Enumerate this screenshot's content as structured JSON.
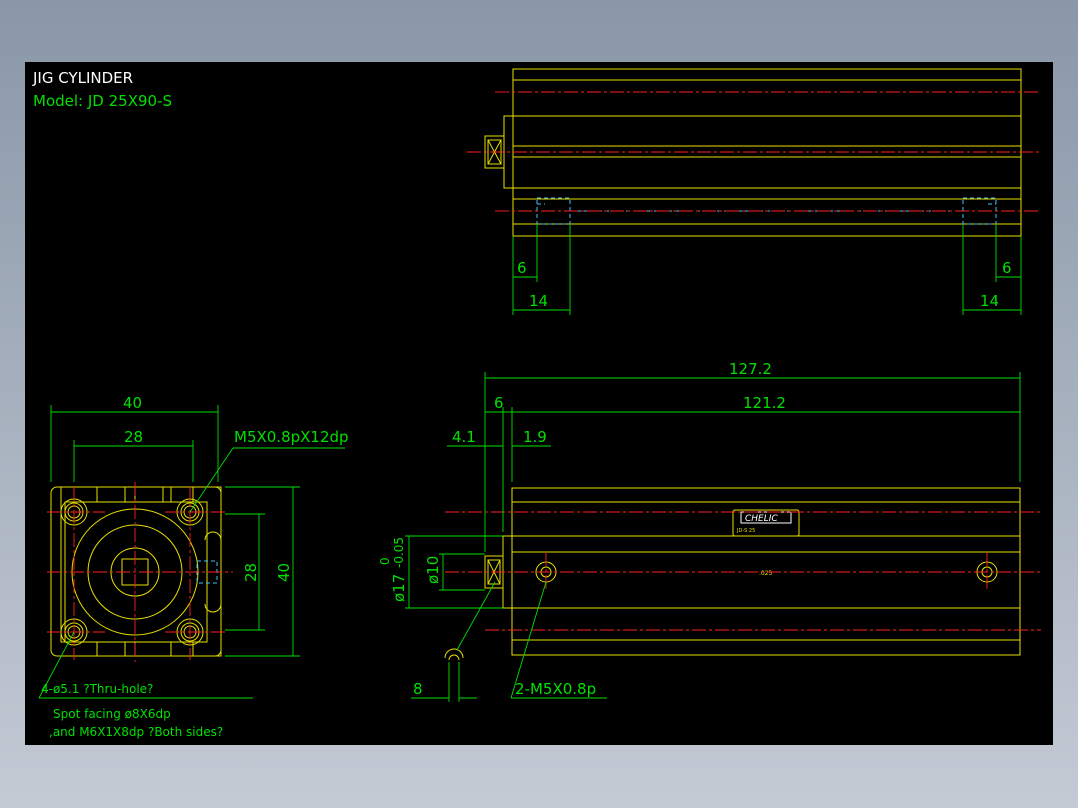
{
  "title": {
    "name": "JIG CYLINDER",
    "model": "Model: JD 25X90-S"
  },
  "colors": {
    "background": "#000000",
    "outline": "#e8e000",
    "dimension": "#00e000",
    "centerline": "#ff2020",
    "hidden": "#40c0ff"
  },
  "top_view": {
    "dims": {
      "left_inner": "6",
      "left_outer": "14",
      "right_inner": "6",
      "right_outer": "14"
    }
  },
  "front_view": {
    "dims": {
      "width": "40",
      "hole_pitch": "28",
      "thread_note": "M5X0.8pX12dp",
      "side_pitch": "28",
      "height": "40"
    },
    "notes": {
      "line1": "4-ø5.1 ?Thru-hole?",
      "line2": "Spot facing  ø8X6dp",
      "line3": ",and  M6X1X8dp ?Both sides?"
    }
  },
  "side_view": {
    "dims": {
      "overall": "127.2",
      "body": "121.2",
      "offset": "6",
      "rod_end": "4.1",
      "flange": "1.9",
      "rod_dia": "ø10",
      "bore": "ø17",
      "tol_upper": "0",
      "tol_lower": "-0.05",
      "wrench": "8",
      "port": "2-M5X0.8p"
    },
    "label": {
      "brand": "CHELIC",
      "small_text": "JD-S 25"
    },
    "center_mark": ".025"
  }
}
